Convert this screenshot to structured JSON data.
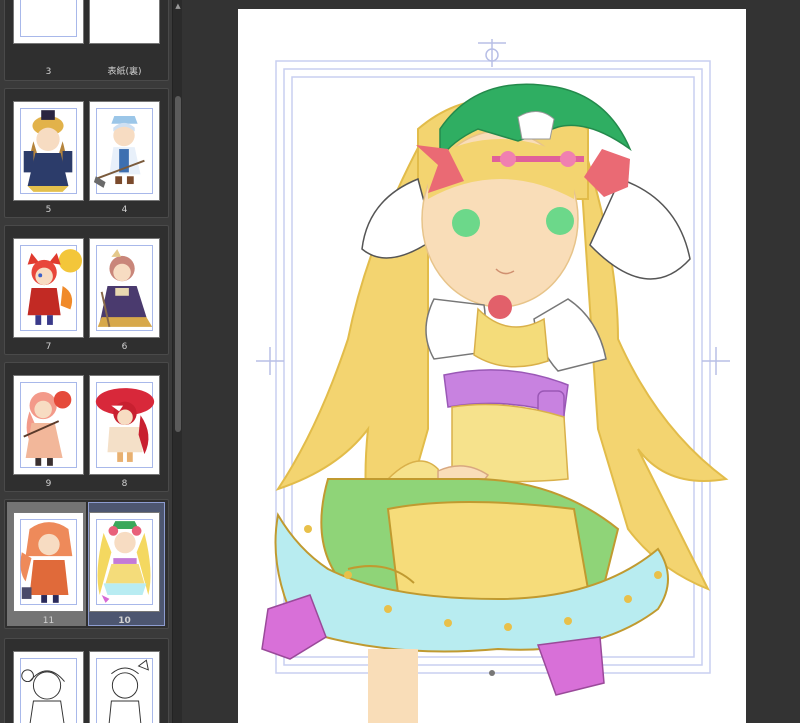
{
  "page_list": {
    "spreads": [
      {
        "left_label": "3",
        "right_label": "表紙(裏)"
      },
      {
        "left_label": "5",
        "right_label": "4"
      },
      {
        "left_label": "7",
        "right_label": "6"
      },
      {
        "left_label": "9",
        "right_label": "8"
      },
      {
        "left_label": "11",
        "right_label": "10",
        "selected": true
      },
      {
        "left_label": "",
        "right_label": ""
      }
    ]
  },
  "colors": {
    "panel_bg": "#3a3a3a",
    "canvas_bg": "#333333",
    "selection_highlight": "#4d5670",
    "guide_lines": "#a8b8ea"
  },
  "icons": [
    "scroll-up-arrow-icon"
  ]
}
